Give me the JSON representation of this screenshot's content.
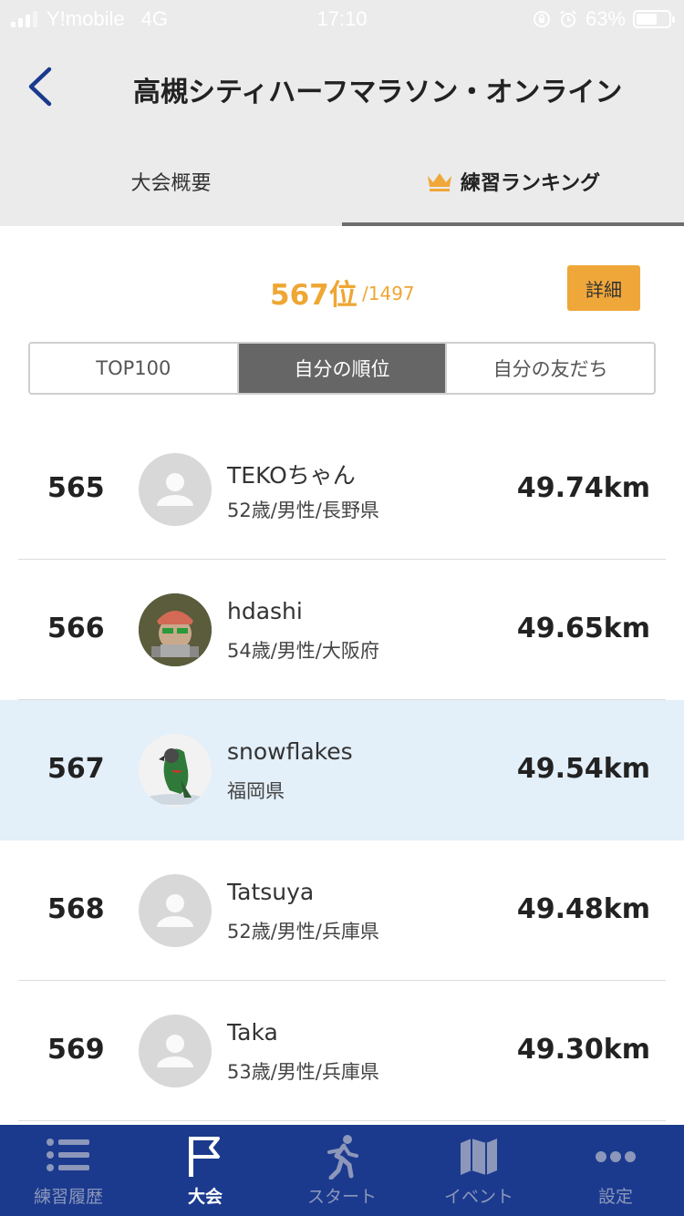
{
  "status_bar": {
    "carrier": "Y!mobile",
    "network": "4G",
    "time": "17:10",
    "battery": "63%"
  },
  "header": {
    "title": "高槻シティハーフマラソン・オンライン"
  },
  "tabs": [
    {
      "label": "大会概要",
      "active": false
    },
    {
      "label": "練習ランキング",
      "active": true
    }
  ],
  "summary": {
    "rank": "567位",
    "total": "/1497",
    "detail_label": "詳細"
  },
  "segments": [
    {
      "label": "TOP100",
      "active": false
    },
    {
      "label": "自分の順位",
      "active": true
    },
    {
      "label": "自分の友だち",
      "active": false
    }
  ],
  "ranking": [
    {
      "rank": "565",
      "name": "TEKOちゃん",
      "info": "52歳/男性/長野県",
      "distance": "49.74km",
      "avatar": "default-avatar",
      "highlight": false
    },
    {
      "rank": "566",
      "name": "hdashi",
      "info": "54歳/男性/大阪府",
      "distance": "49.65km",
      "avatar": "photo-avatar",
      "highlight": false
    },
    {
      "rank": "567",
      "name": "snowflakes",
      "info": "福岡県",
      "distance": "49.54km",
      "avatar": "bird-photo-avatar",
      "highlight": true
    },
    {
      "rank": "568",
      "name": "Tatsuya",
      "info": "52歳/男性/兵庫県",
      "distance": "49.48km",
      "avatar": "default-avatar",
      "highlight": false
    },
    {
      "rank": "569",
      "name": "Taka",
      "info": "53歳/男性/兵庫県",
      "distance": "49.30km",
      "avatar": "default-avatar",
      "highlight": false
    }
  ],
  "bottom_nav": [
    {
      "label": "練習履歴",
      "icon": "list-icon",
      "active": false
    },
    {
      "label": "大会",
      "icon": "flag-icon",
      "active": true
    },
    {
      "label": "スタート",
      "icon": "runner-icon",
      "active": false
    },
    {
      "label": "イベント",
      "icon": "map-icon",
      "active": false
    },
    {
      "label": "設定",
      "icon": "more-icon",
      "active": false
    }
  ],
  "colors": {
    "accent": "#efa633",
    "nav_bg": "#1b3a8e",
    "highlight_row": "#e3eff9",
    "back_arrow": "#1b3a8e"
  }
}
